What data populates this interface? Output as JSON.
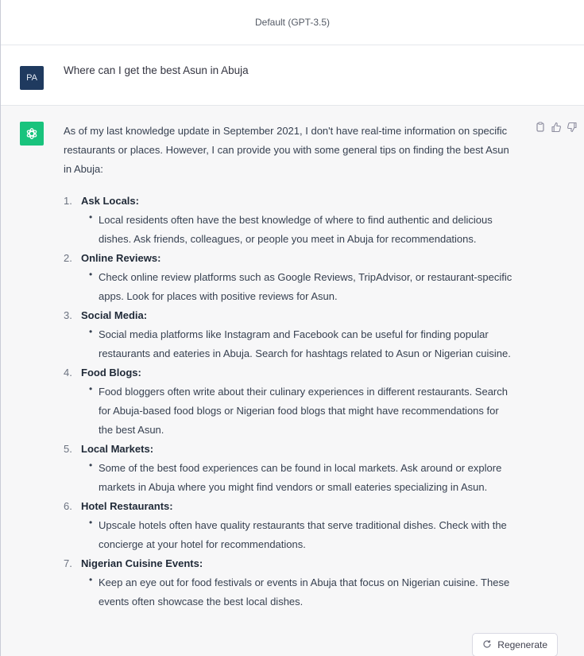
{
  "header": {
    "model_label": "Default (GPT-3.5)"
  },
  "user": {
    "avatar_initials": "PA",
    "message": "Where can I get the best Asun in Abuja"
  },
  "assistant": {
    "avatar_icon": "openai-logo-icon",
    "intro": "As of my last knowledge update in September 2021, I don't have real-time information on specific restaurants or places. However, I can provide you with some general tips on finding the best Asun in Abuja:",
    "tips": [
      {
        "number": "1.",
        "title": "Ask Locals:",
        "detail": "Local residents often have the best knowledge of where to find authentic and delicious dishes. Ask friends, colleagues, or people you meet in Abuja for recommendations."
      },
      {
        "number": "2.",
        "title": "Online Reviews:",
        "detail": "Check online review platforms such as Google Reviews, TripAdvisor, or restaurant-specific apps. Look for places with positive reviews for Asun."
      },
      {
        "number": "3.",
        "title": "Social Media:",
        "detail": "Social media platforms like Instagram and Facebook can be useful for finding popular restaurants and eateries in Abuja. Search for hashtags related to Asun or Nigerian cuisine."
      },
      {
        "number": "4.",
        "title": "Food Blogs:",
        "detail": "Food bloggers often write about their culinary experiences in different restaurants. Search for Abuja-based food blogs or Nigerian food blogs that might have recommendations for the best Asun."
      },
      {
        "number": "5.",
        "title": "Local Markets:",
        "detail": "Some of the best food experiences can be found in local markets. Ask around or explore markets in Abuja where you might find vendors or small eateries specializing in Asun."
      },
      {
        "number": "6.",
        "title": "Hotel Restaurants:",
        "detail": "Upscale hotels often have quality restaurants that serve traditional dishes. Check with the concierge at your hotel for recommendations."
      },
      {
        "number": "7.",
        "title": "Nigerian Cuisine Events:",
        "detail": "Keep an eye out for food festivals or events in Abuja that focus on Nigerian cuisine. These events often showcase the best local dishes."
      }
    ],
    "actions": [
      "copy-icon",
      "thumbs-up-icon",
      "thumbs-down-icon"
    ]
  },
  "regenerate": {
    "label": "Regenerate",
    "icon": "refresh-icon"
  },
  "colors": {
    "user_avatar": "#1f3a5f",
    "bot_avatar": "#19c37d",
    "assistant_bg": "#f7f7f8"
  }
}
